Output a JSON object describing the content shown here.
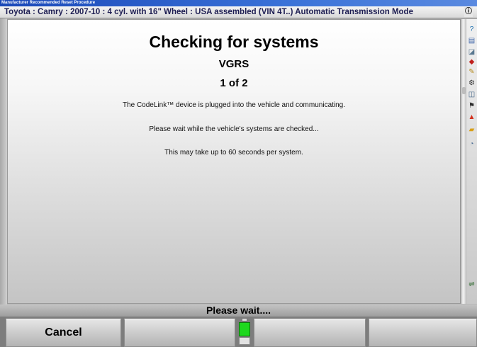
{
  "window": {
    "title": "Manufacturer Recommended Reset Procedure"
  },
  "vehicle": {
    "description": "Toyota : Camry : 2007-10 : 4 cyl. with 16\" Wheel : USA assembled (VIN 4T..) Automatic Transmission Mode",
    "info_icon": "info-icon"
  },
  "main": {
    "title": "Checking for systems",
    "subtitle": "VGRS",
    "counter": "1 of 2",
    "messages": [
      "The CodeLink™ device is plugged into the vehicle and communicating.",
      "Please wait while the vehicle's systems are checked...",
      "This may take up to 60 seconds per system."
    ]
  },
  "toolbar": {
    "icons": [
      "help-icon",
      "vehicle-lift-icon",
      "tool-icon",
      "wrench-icon",
      "checklist-icon",
      "page-icon",
      "settings-icon",
      "flag-icon",
      "lift-icon",
      "printer-icon",
      "gauge-icon",
      "link-icon"
    ]
  },
  "status": {
    "text": "Please wait...."
  },
  "softkeys": [
    {
      "label": "Cancel"
    },
    {
      "label": ""
    },
    {
      "label": ""
    },
    {
      "label": ""
    }
  ],
  "busy_indicator": {
    "color": "#1ed81e"
  },
  "colors": {
    "titlebar": "#1a48b8",
    "vehicle_text": "#1d1d52"
  }
}
